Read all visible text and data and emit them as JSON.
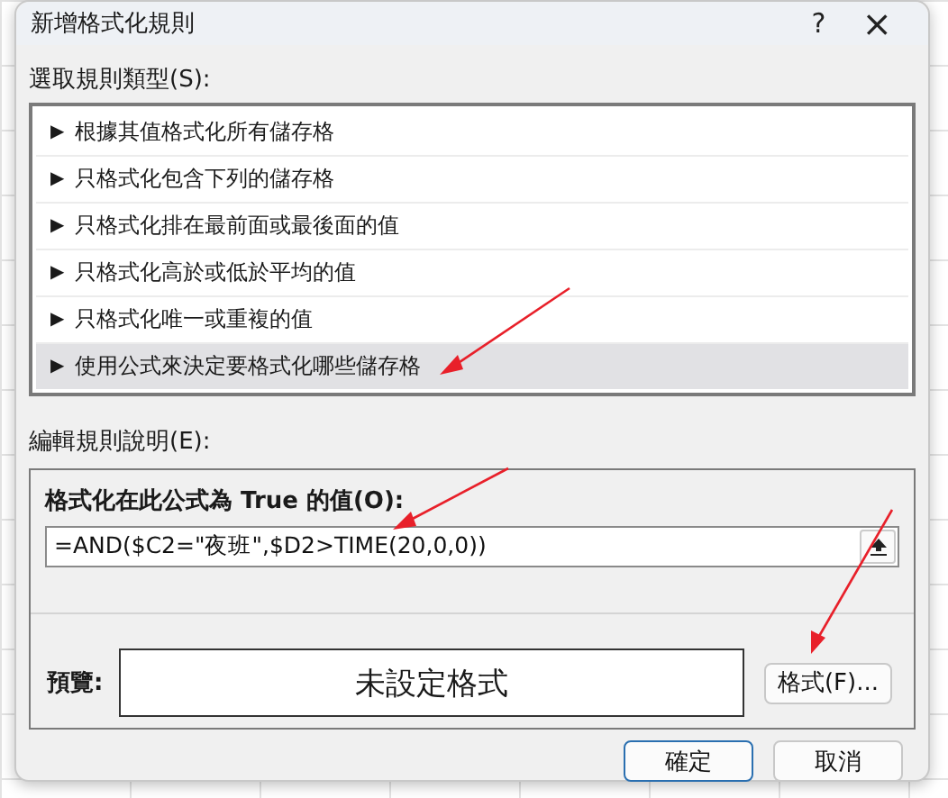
{
  "window": {
    "title": "新增格式化規則",
    "help": "?",
    "close": "×"
  },
  "rule_type": {
    "label": "選取規則類型(S):",
    "items": [
      {
        "bullet": "▶",
        "label": "根據其值格式化所有儲存格",
        "selected": false
      },
      {
        "bullet": "▶",
        "label": "只格式化包含下列的儲存格",
        "selected": false
      },
      {
        "bullet": "▶",
        "label": "只格式化排在最前面或最後面的值",
        "selected": false
      },
      {
        "bullet": "▶",
        "label": "只格式化高於或低於平均的值",
        "selected": false
      },
      {
        "bullet": "▶",
        "label": "只格式化唯一或重複的值",
        "selected": false
      },
      {
        "bullet": "▶",
        "label": "使用公式來決定要格式化哪些儲存格",
        "selected": true
      }
    ]
  },
  "rule_description": {
    "label": "編輯規則說明(E):",
    "formula_label": "格式化在此公式為 True 的值(O):",
    "formula": "=AND($C2=\"夜班\",$D2>TIME(20,0,0))",
    "preview_label": "預覽:",
    "preview_text": "未設定格式",
    "format_button": "格式(F)..."
  },
  "buttons": [
    "確定",
    "取消"
  ]
}
